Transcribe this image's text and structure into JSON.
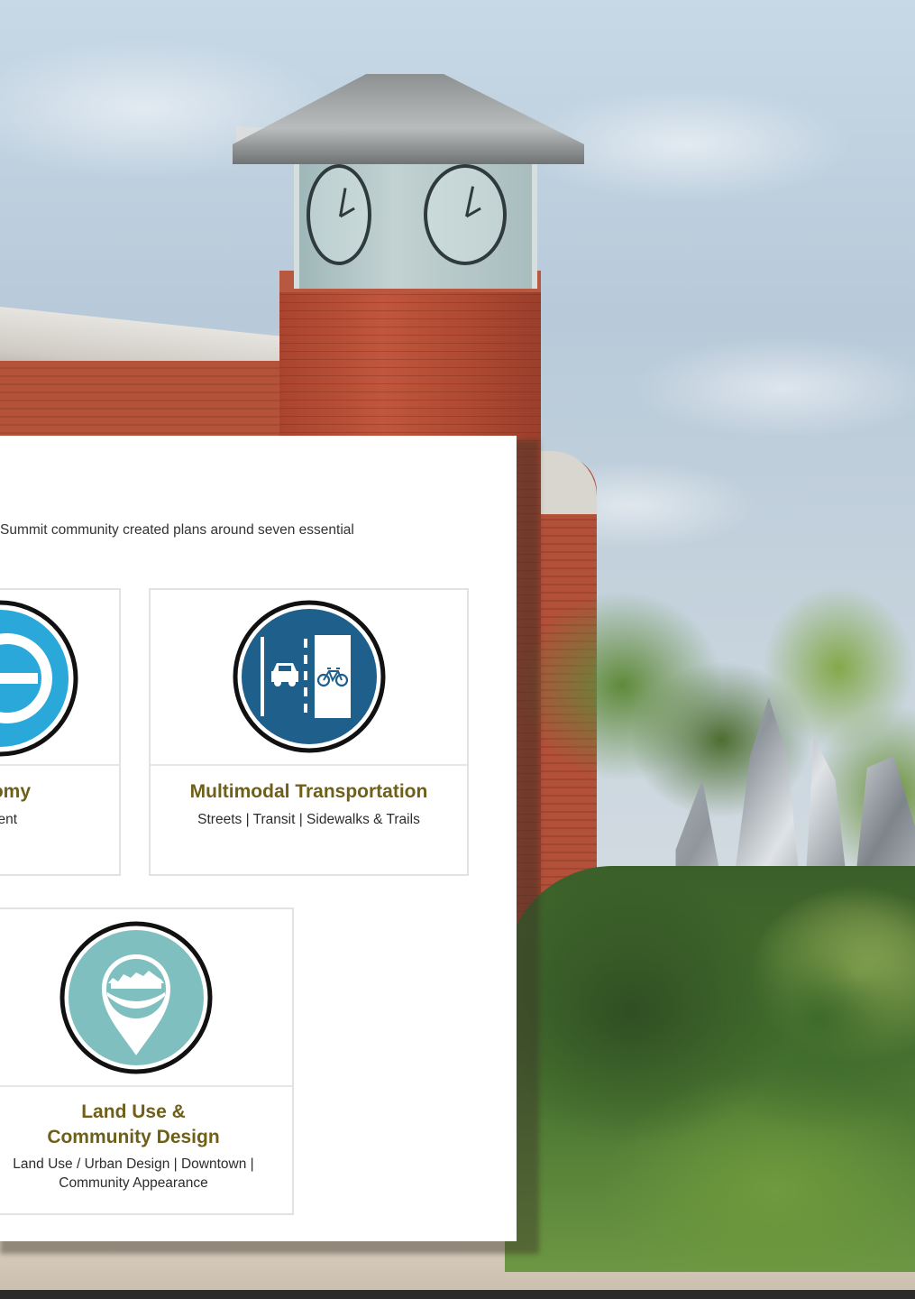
{
  "intro_text": "Summit community created plans around seven essential",
  "tiles": [
    {
      "title": "nomy",
      "subtitle": "pment",
      "icon": "economy-icon",
      "icon_color": "#29a8d9"
    },
    {
      "title": "Multimodal Transportation",
      "subtitle": "Streets | Transit | Sidewalks & Trails",
      "icon": "car-bike-lanes-icon",
      "icon_color": "#1f5f8b"
    },
    {
      "title": "Land Use & Community Design",
      "subtitle": "Land Use / Urban Design | Downtown | Community Appearance",
      "icon": "map-pin-town-icon",
      "icon_color": "#7fbfbf"
    }
  ],
  "colors": {
    "title_color": "#6f5f19",
    "card_background": "#ffffff"
  }
}
